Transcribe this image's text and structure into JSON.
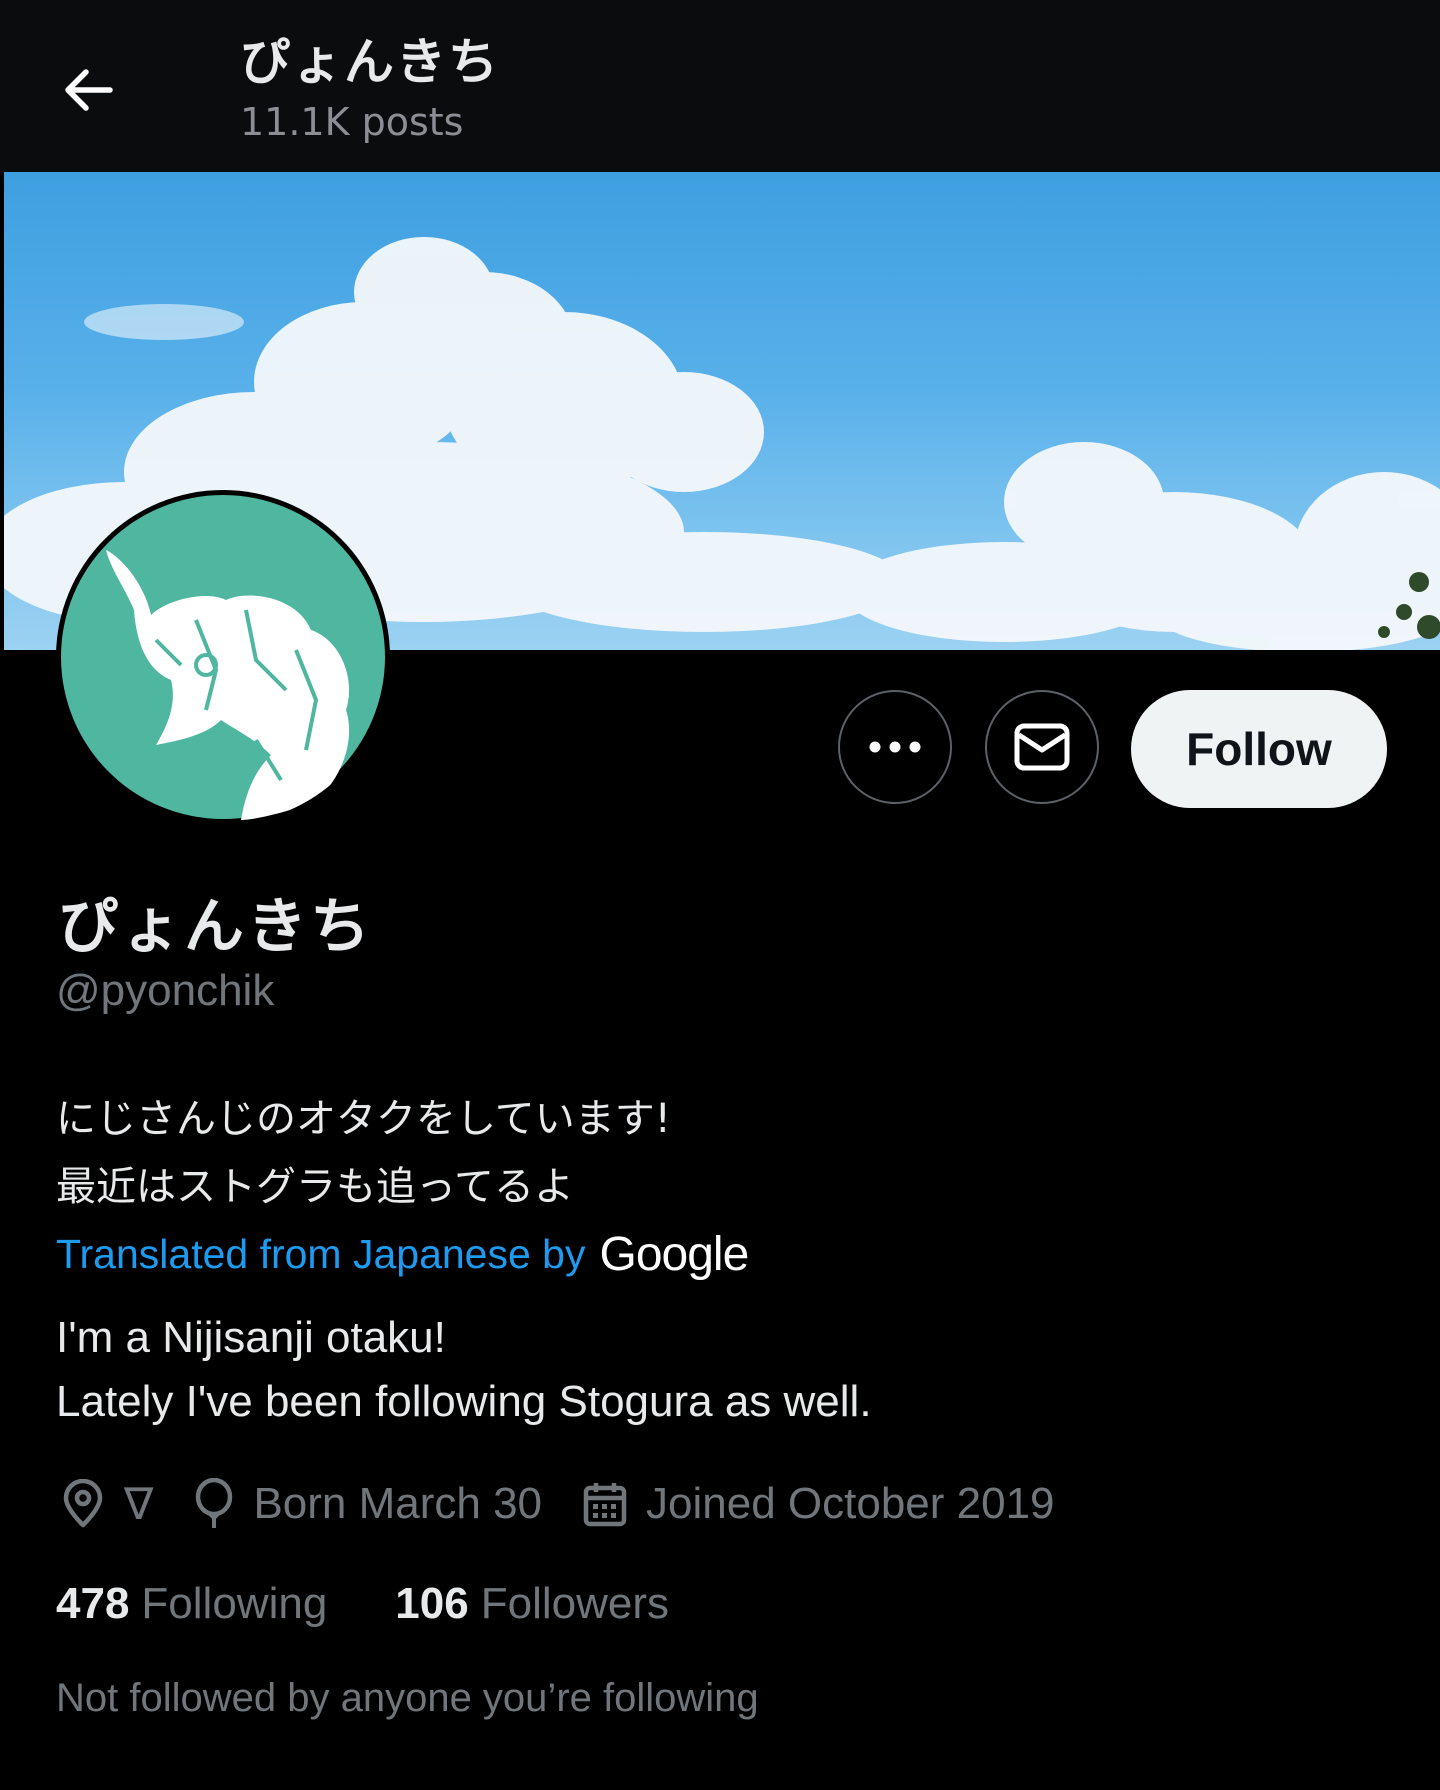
{
  "header": {
    "title": "ぴょんきち",
    "posts_count": "11.1K posts"
  },
  "profile": {
    "display_name": "ぴょんきち",
    "handle": "@pyonchik",
    "bio_lines": [
      "にじさんじのオタクをしています!",
      "最近はストグラも追ってるよ"
    ],
    "translated_label": "Translated from Japanese by",
    "translator_brand": "Google",
    "translation_lines": [
      "I'm a Nijisanji otaku!",
      "Lately I've been following Stogura as well."
    ],
    "location": "∇",
    "birthday": "Born March 30",
    "joined": "Joined October 2019"
  },
  "actions": {
    "follow_label": "Follow"
  },
  "stats": {
    "following_count": "478",
    "following_label": "Following",
    "followers_count": "106",
    "followers_label": "Followers"
  },
  "social_context": "Not followed by anyone you’re following",
  "colors": {
    "accent": "#1d9bf0",
    "avatar_bg": "#4fb79f"
  },
  "icons": [
    "back-arrow-icon",
    "more-icon",
    "mail-icon",
    "location-icon",
    "balloon-icon",
    "calendar-icon"
  ]
}
